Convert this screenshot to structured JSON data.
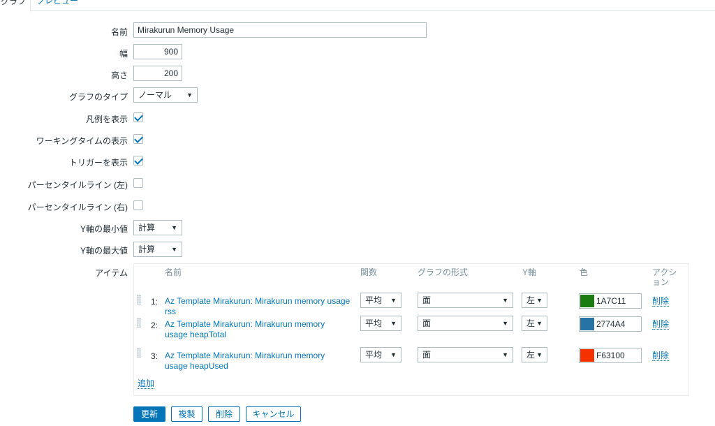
{
  "tabs": [
    {
      "label": "グラフ",
      "active": true
    },
    {
      "label": "プレビュー",
      "active": false
    }
  ],
  "form": {
    "name": {
      "label": "名前",
      "value": "Mirakurun Memory Usage"
    },
    "width": {
      "label": "幅",
      "value": "900"
    },
    "height": {
      "label": "高さ",
      "value": "200"
    },
    "graph_type": {
      "label": "グラフのタイプ",
      "value": "ノーマル"
    },
    "show_legend": {
      "label": "凡例を表示",
      "checked": true
    },
    "show_working_time": {
      "label": "ワーキングタイムの表示",
      "checked": true
    },
    "show_triggers": {
      "label": "トリガーを表示",
      "checked": true
    },
    "percentile_left": {
      "label": "パーセンタイルライン (左)",
      "checked": false
    },
    "percentile_right": {
      "label": "パーセンタイルライン (右)",
      "checked": false
    },
    "y_min": {
      "label": "Y軸の最小値",
      "value": "計算"
    },
    "y_max": {
      "label": "Y軸の最大値",
      "value": "計算"
    },
    "items_label": "アイテム"
  },
  "items": {
    "headers": {
      "name": "名前",
      "function": "関数",
      "draw_style": "グラフの形式",
      "y_axis": "Y軸",
      "color": "色",
      "action": "アクション"
    },
    "rows": [
      {
        "index": "1:",
        "name": "Az Template Mirakurun: Mirakurun memory usage rss",
        "function": "平均",
        "draw_style": "面",
        "y_axis": "左",
        "color_hex": "1A7C11",
        "color": "#1A7C11",
        "action": "削除"
      },
      {
        "index": "2:",
        "name": "Az Template Mirakurun: Mirakurun memory usage heapTotal",
        "function": "平均",
        "draw_style": "面",
        "y_axis": "左",
        "color_hex": "2774A4",
        "color": "#2774A4",
        "action": "削除"
      },
      {
        "index": "3:",
        "name": "Az Template Mirakurun: Mirakurun memory usage heapUsed",
        "function": "平均",
        "draw_style": "面",
        "y_axis": "左",
        "color_hex": "F63100",
        "color": "#F63100",
        "action": "削除"
      }
    ],
    "add_label": "追加"
  },
  "buttons": {
    "update": "更新",
    "clone": "複製",
    "delete": "削除",
    "cancel": "キャンセル"
  }
}
